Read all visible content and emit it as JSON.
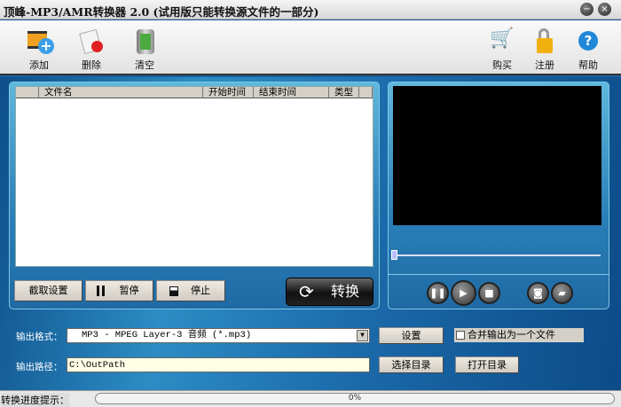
{
  "window": {
    "title": "顶峰-MP3/AMR转换器 2.0 (试用版只能转换源文件的一部分)",
    "minimize": "−",
    "close": "×"
  },
  "toolbar": {
    "add": "添加",
    "delete": "删除",
    "clear": "清空",
    "buy": "购买",
    "register": "注册",
    "help": "帮助"
  },
  "list": {
    "columns": [
      "",
      "文件名",
      "开始时间",
      "结束时间",
      "类型"
    ]
  },
  "controls": {
    "clip_settings": "截取设置",
    "pause": "暂停",
    "stop": "停止",
    "convert": "转换"
  },
  "player": {
    "position_percent": 0
  },
  "output": {
    "format_label": "输出格式：",
    "format_value": "MP3 - MPEG Layer-3 音频 (*.mp3)",
    "settings": "设置",
    "merge_label": "合并输出为一个文件",
    "merge_checked": false,
    "path_label": "输出路径：",
    "path_value": "C:\\OutPath",
    "choose_dir": "选择目录",
    "open_dir": "打开目录"
  },
  "status": {
    "label": "转换进度提示：",
    "progress_text": "0%",
    "progress_percent": 0
  }
}
